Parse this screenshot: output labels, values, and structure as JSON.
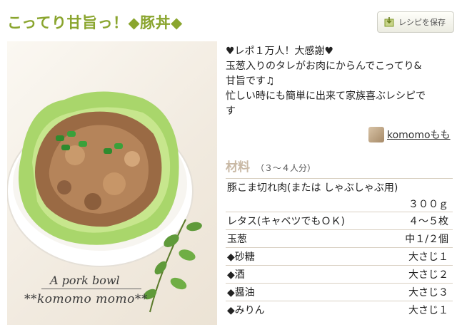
{
  "recipe": {
    "title": "こってり甘旨っ！◆豚丼◆",
    "save_label": "レシピを保存",
    "photo_caption_1": "A pork bowl",
    "photo_caption_2": "**komomo momo**",
    "description": [
      "♥レポ１万人！大感謝♥",
      "玉葱入りのタレがお肉にからんでこってり&",
      "甘旨です♫",
      "忙しい時にも簡単に出来て家族喜ぶレシピで",
      "す"
    ],
    "author": "komomoもも"
  },
  "ingredients": {
    "heading": "材料",
    "servings": "（３〜４人分）",
    "items": [
      {
        "name": "豚こま切れ肉(または しゃぶしゃぶ用)",
        "amount": "３００ｇ"
      },
      {
        "name": "レタス(キャベツでもＯＫ)",
        "amount": "４〜５枚"
      },
      {
        "name": "玉葱",
        "amount": "中１/２個"
      },
      {
        "name": "◆砂糖",
        "amount": "大さじ１"
      },
      {
        "name": "◆酒",
        "amount": "大さじ２"
      },
      {
        "name": "◆醤油",
        "amount": "大さじ３"
      },
      {
        "name": "◆みりん",
        "amount": "大さじ１"
      }
    ]
  },
  "icons": {
    "save": "save-recipe-icon",
    "avatar": "author-avatar"
  },
  "colors": {
    "title": "#8aa52e",
    "ingredients_heading": "#c9b9a5"
  }
}
